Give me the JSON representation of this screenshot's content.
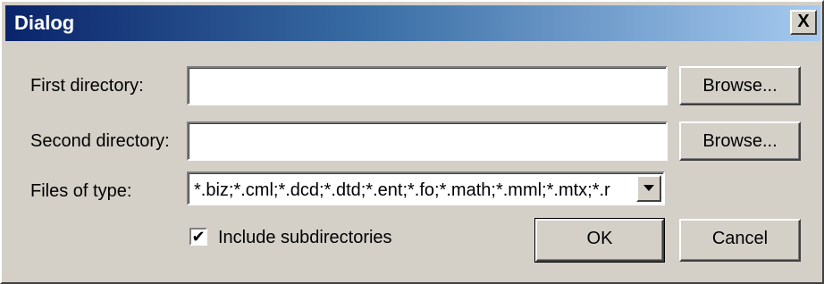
{
  "window": {
    "title": "Dialog",
    "close_label": "X"
  },
  "form": {
    "first_directory": {
      "label": "First directory:",
      "value": "",
      "browse_label": "Browse..."
    },
    "second_directory": {
      "label": "Second directory:",
      "value": "",
      "browse_label": "Browse..."
    },
    "files_of_type": {
      "label": "Files of type:",
      "selected": "*.biz;*.cml;*.dcd;*.dtd;*.ent;*.fo;*.math;*.mml;*.mtx;*.r"
    },
    "include_subdirectories": {
      "label": "Include subdirectories",
      "checked": true
    }
  },
  "buttons": {
    "ok_label": "OK",
    "cancel_label": "Cancel"
  },
  "icons": {
    "check": "✔",
    "dropdown": "chevron-down-icon"
  }
}
